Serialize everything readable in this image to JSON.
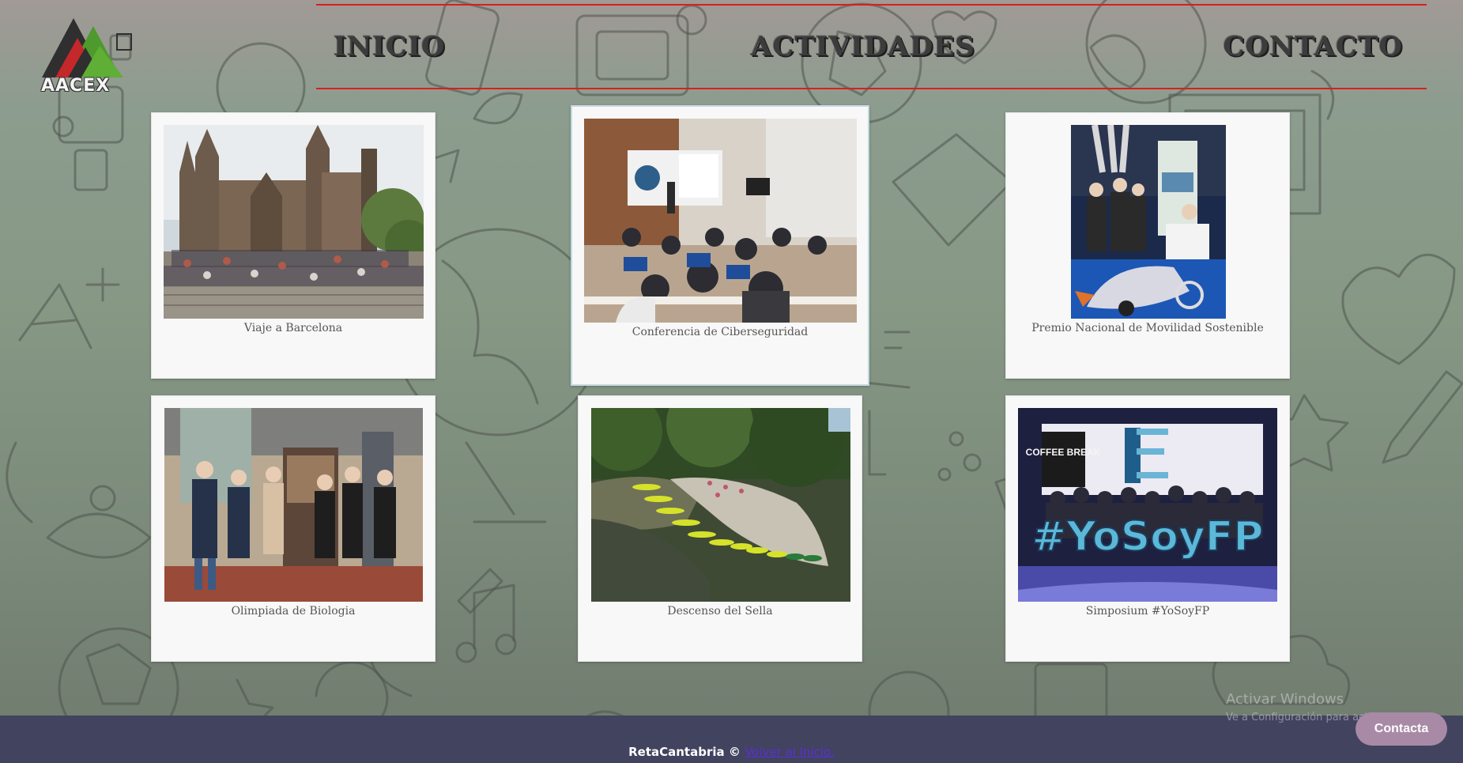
{
  "brand": {
    "logo_text": "AACEX",
    "logo_icon": "mountain-triangles-logo",
    "colors": {
      "logo_red": "#c4282a",
      "logo_green": "#4e9a2c",
      "logo_dark": "#2f2f2f"
    }
  },
  "nav": {
    "items": [
      {
        "label": "INICIO"
      },
      {
        "label": "ACTIVIDADES"
      },
      {
        "label": "CONTACTO"
      }
    ],
    "accent": "#d62020"
  },
  "activities": [
    {
      "caption": "Viaje a Barcelona",
      "photo": "cathedral-group-photo"
    },
    {
      "caption": "Conferencia de Ciberseguridad",
      "photo": "classroom-laptops-photo"
    },
    {
      "caption": "Premio Nacional de Movilidad Sostenible",
      "photo": "students-vehicle-photo"
    },
    {
      "caption": "Olimpiada de Biologia",
      "photo": "group-exhibition-photo"
    },
    {
      "caption": "Descenso del Sella",
      "photo": "river-canoes-photo"
    },
    {
      "caption": "Simposium #YoSoyFP",
      "photo": "yosoyfp-stage-photo"
    }
  ],
  "photo_text": {
    "coffee_break": "COFFEE BREAK",
    "hashtag": "#YoSoyFP"
  },
  "footer": {
    "copyright": "RetaCantabria ©",
    "link_label": "Volver al Inicio."
  },
  "windows_watermark": {
    "title": "Activar Windows",
    "subtitle": "Ve a Configuración para activar Windows."
  },
  "contact_button": {
    "label": "Contacta"
  }
}
